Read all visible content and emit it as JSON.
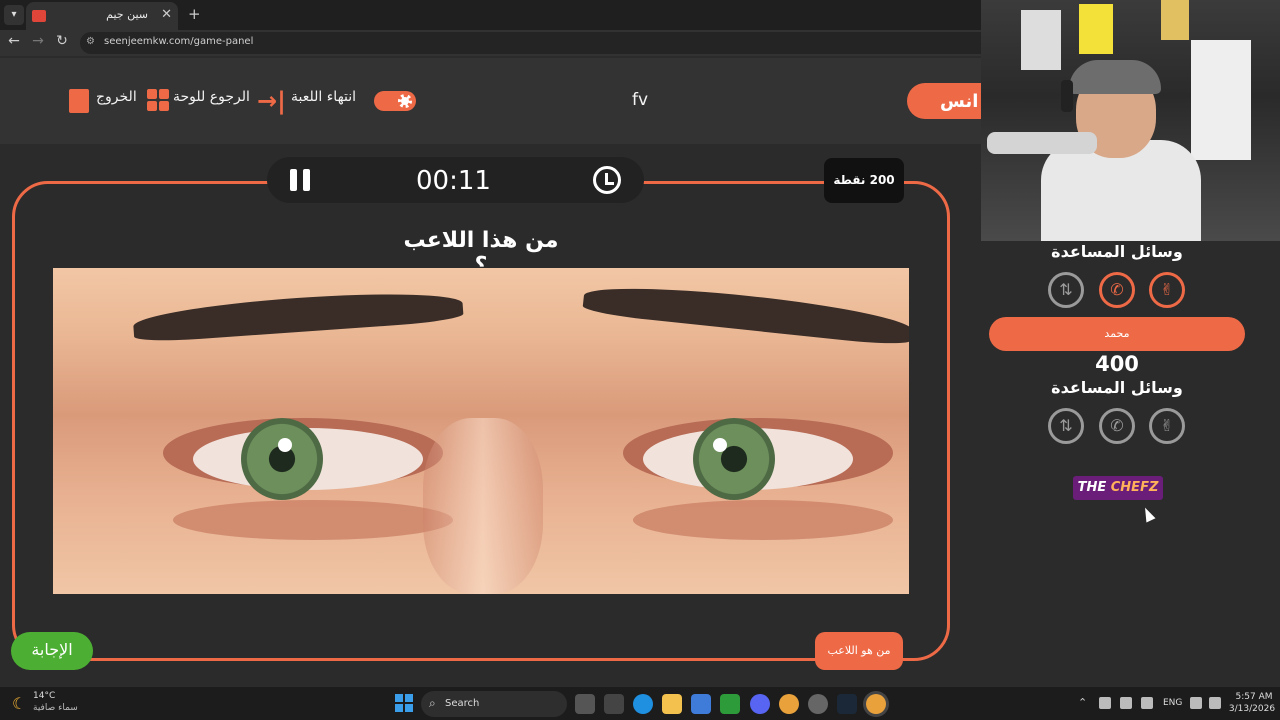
{
  "browser": {
    "tab_title": "سين جيم",
    "url": "seenjeemkw.com/game-panel"
  },
  "header": {
    "exit_label": "الخروج",
    "board_label": "الرجوع للوحة",
    "end_game_label": "انتهاء اللعبة",
    "team_left": "fv",
    "team_right": "انس"
  },
  "question": {
    "timer": "00:11",
    "points": "200 نقطة",
    "text": "من هذا اللاعب ؟",
    "answer_button": "الإجابة",
    "category_button": "من هو اللاعب"
  },
  "sidebar": {
    "team1_aids_title": "وسائل المساعدة",
    "team2_name": "محمد",
    "team2_score": "400",
    "team2_aids_title": "وسائل المساعدة",
    "logo_the": "THE ",
    "logo_chefz": "CHEFZ"
  },
  "taskbar": {
    "weather_temp": "14°C",
    "weather_desc": "سماء صافية",
    "search_label": "Search",
    "lang": "ENG",
    "time": "5:57 AM",
    "date": "3/13/2026"
  },
  "colors": {
    "accent": "#ee6a47",
    "answer_green": "#4caf33",
    "background": "#2b2b2b"
  }
}
